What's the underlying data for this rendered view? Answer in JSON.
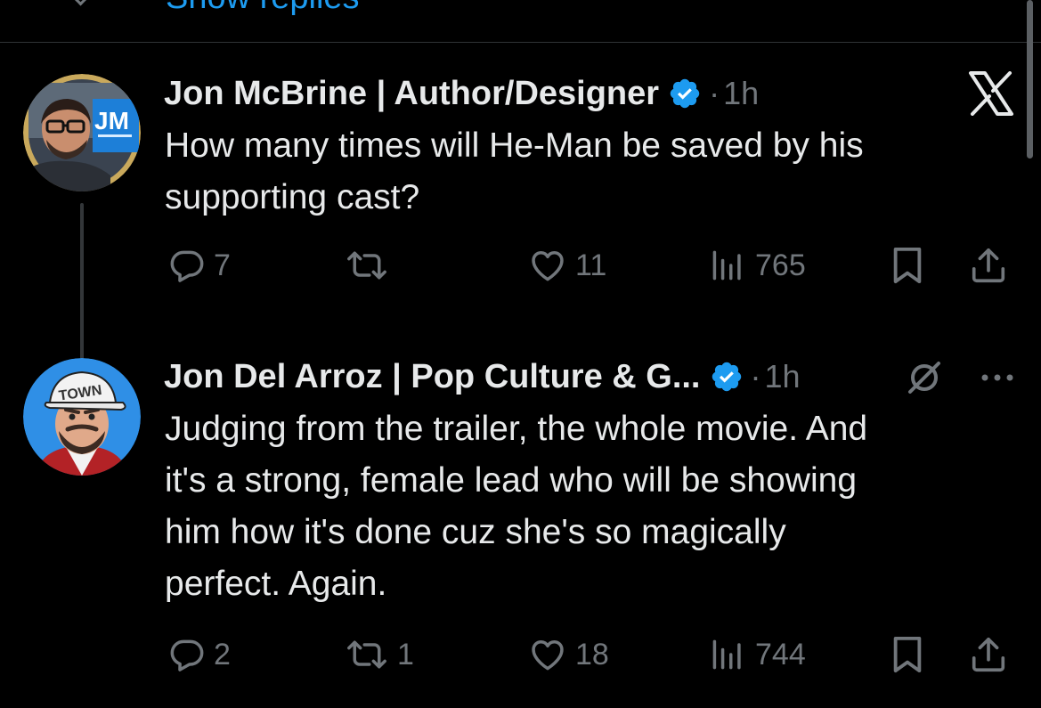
{
  "top": {
    "show_replies_label": "Show replies"
  },
  "colors": {
    "background": "#000000",
    "text": "#e7e9ea",
    "muted": "#71767b",
    "accent": "#1d9bf0",
    "divider": "#2f3336"
  },
  "tweets": [
    {
      "author_name": "Jon McBrine | Author/Designer",
      "verified": true,
      "separator": "·",
      "time": "1h",
      "body_lines": [
        "How many times will He-Man be saved by his",
        "supporting cast?"
      ],
      "avatar_icon": "avatar-jm-icon",
      "corner_icon": "x-logo-icon",
      "avatar_badge_text": "JM",
      "counts": {
        "replies": "7",
        "reposts": "",
        "likes": "11",
        "views": "765"
      }
    },
    {
      "author_name": "Jon Del Arroz | Pop Culture & G...",
      "verified": true,
      "separator": "·",
      "time": "1h",
      "body_lines": [
        "Judging from the trailer, the whole movie. And",
        "it's a strong, female lead who will be showing",
        "him how it's done cuz she's so magically",
        "perfect. Again."
      ],
      "avatar_icon": "avatar-cartoon-icon",
      "corner_icons": [
        "mute-icon",
        "more-icon"
      ],
      "avatar_badge_text": "TOWN",
      "counts": {
        "replies": "2",
        "reposts": "1",
        "likes": "18",
        "views": "744"
      }
    }
  ],
  "icons": {
    "reply": "reply-bubble-icon",
    "repost": "repost-arrows-icon",
    "like": "heart-icon",
    "views": "bar-chart-icon",
    "bookmark": "bookmark-icon",
    "share": "share-upload-icon",
    "verified": "verified-badge-icon"
  }
}
